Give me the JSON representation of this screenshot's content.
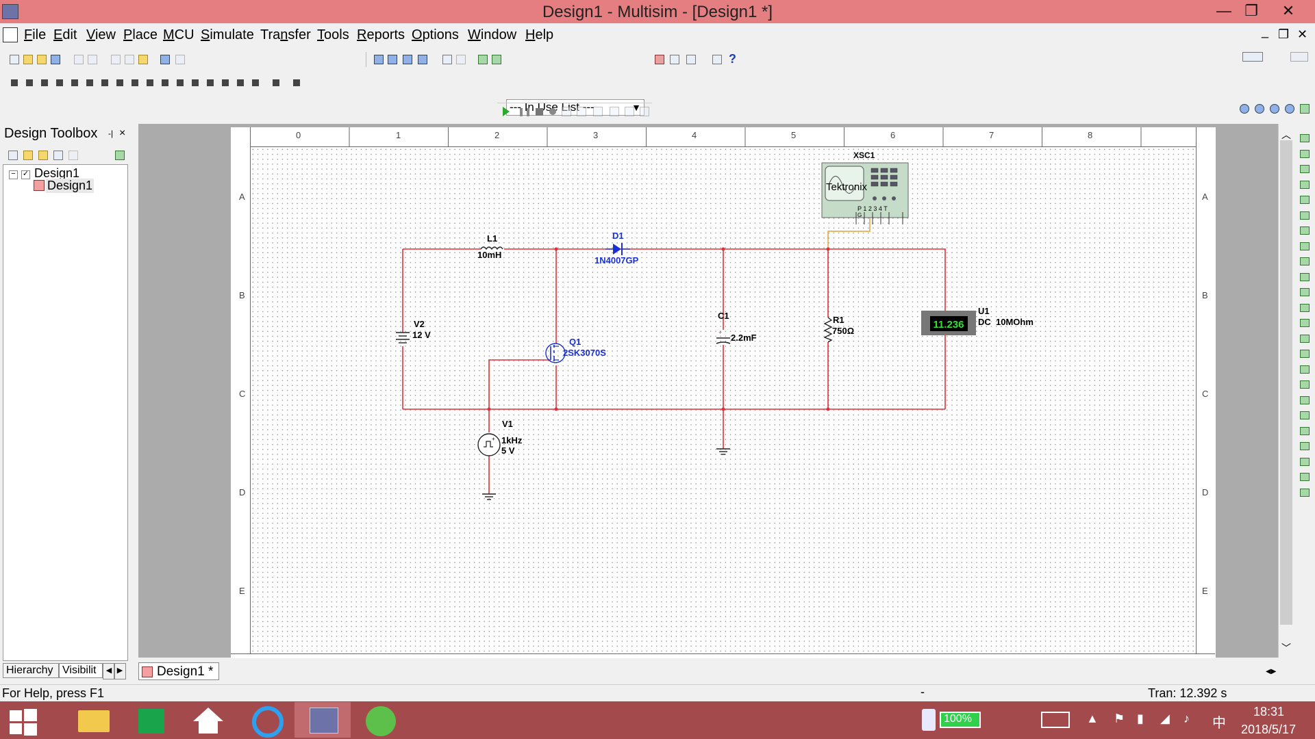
{
  "window": {
    "title": "Design1 - Multisim - [Design1 *]",
    "minimize": "—",
    "restore": "❐",
    "close": "✕"
  },
  "menu": {
    "items": [
      {
        "pre": "",
        "u": "F",
        "post": "ile"
      },
      {
        "pre": "",
        "u": "E",
        "post": "dit"
      },
      {
        "pre": "",
        "u": "V",
        "post": "iew"
      },
      {
        "pre": "",
        "u": "P",
        "post": "lace"
      },
      {
        "pre": "",
        "u": "M",
        "post": "CU"
      },
      {
        "pre": "",
        "u": "S",
        "post": "imulate"
      },
      {
        "pre": "Tra",
        "u": "n",
        "post": "sfer"
      },
      {
        "pre": "",
        "u": "T",
        "post": "ools"
      },
      {
        "pre": "",
        "u": "R",
        "post": "eports"
      },
      {
        "pre": "",
        "u": "O",
        "post": "ptions"
      },
      {
        "pre": "",
        "u": "W",
        "post": "indow"
      },
      {
        "pre": "",
        "u": "H",
        "post": "elp"
      }
    ],
    "doc_min": "_",
    "doc_restore": "❐",
    "doc_close": "✕"
  },
  "toolbar": {
    "in_use_list": "--- In Use List ---",
    "help_icon": "?"
  },
  "toolbox": {
    "title": "Design Toolbox",
    "pin": "-|",
    "close": "×",
    "tree_root": "Design1",
    "tree_child": "Design1",
    "tab_hierarchy": "Hierarchy",
    "tab_visibility": "Visibilit"
  },
  "rulers": {
    "cols": [
      "0",
      "1",
      "2",
      "3",
      "4",
      "5",
      "6",
      "7",
      "8"
    ],
    "rows": [
      "A",
      "B",
      "C",
      "D",
      "E"
    ]
  },
  "schematic": {
    "L1": {
      "ref": "L1",
      "value": "10mH"
    },
    "D1": {
      "ref": "D1",
      "value": "1N4007GP"
    },
    "V2": {
      "ref": "V2",
      "value": "12 V"
    },
    "Q1": {
      "ref": "Q1",
      "value": "2SK3070S"
    },
    "C1": {
      "ref": "C1",
      "value": "2.2mF"
    },
    "R1": {
      "ref": "R1",
      "value": "750Ω"
    },
    "U1": {
      "ref": "U1",
      "mode": "DC",
      "value": "10MOhm",
      "reading": "11.236"
    },
    "V1": {
      "ref": "V1",
      "freq": "1kHz",
      "amp": "5 V"
    },
    "XSC1": {
      "ref": "XSC1",
      "brand": "Tektronix",
      "pins": "P 1 2 3 4 T",
      "pin_g": "G"
    }
  },
  "doc_tab": "Design1 *",
  "status": {
    "help": "For Help, press F1",
    "dash": "-",
    "tran": "Tran: 12.392 s"
  },
  "taskbar": {
    "battery": "100%",
    "ime": "中",
    "time": "18:31",
    "date": "2018/5/17"
  },
  "colors": {
    "titlebar": "#e57e80",
    "taskbar": "#a34a4c",
    "wire": "#e0303a",
    "component_blue": "#1a2fd6"
  }
}
